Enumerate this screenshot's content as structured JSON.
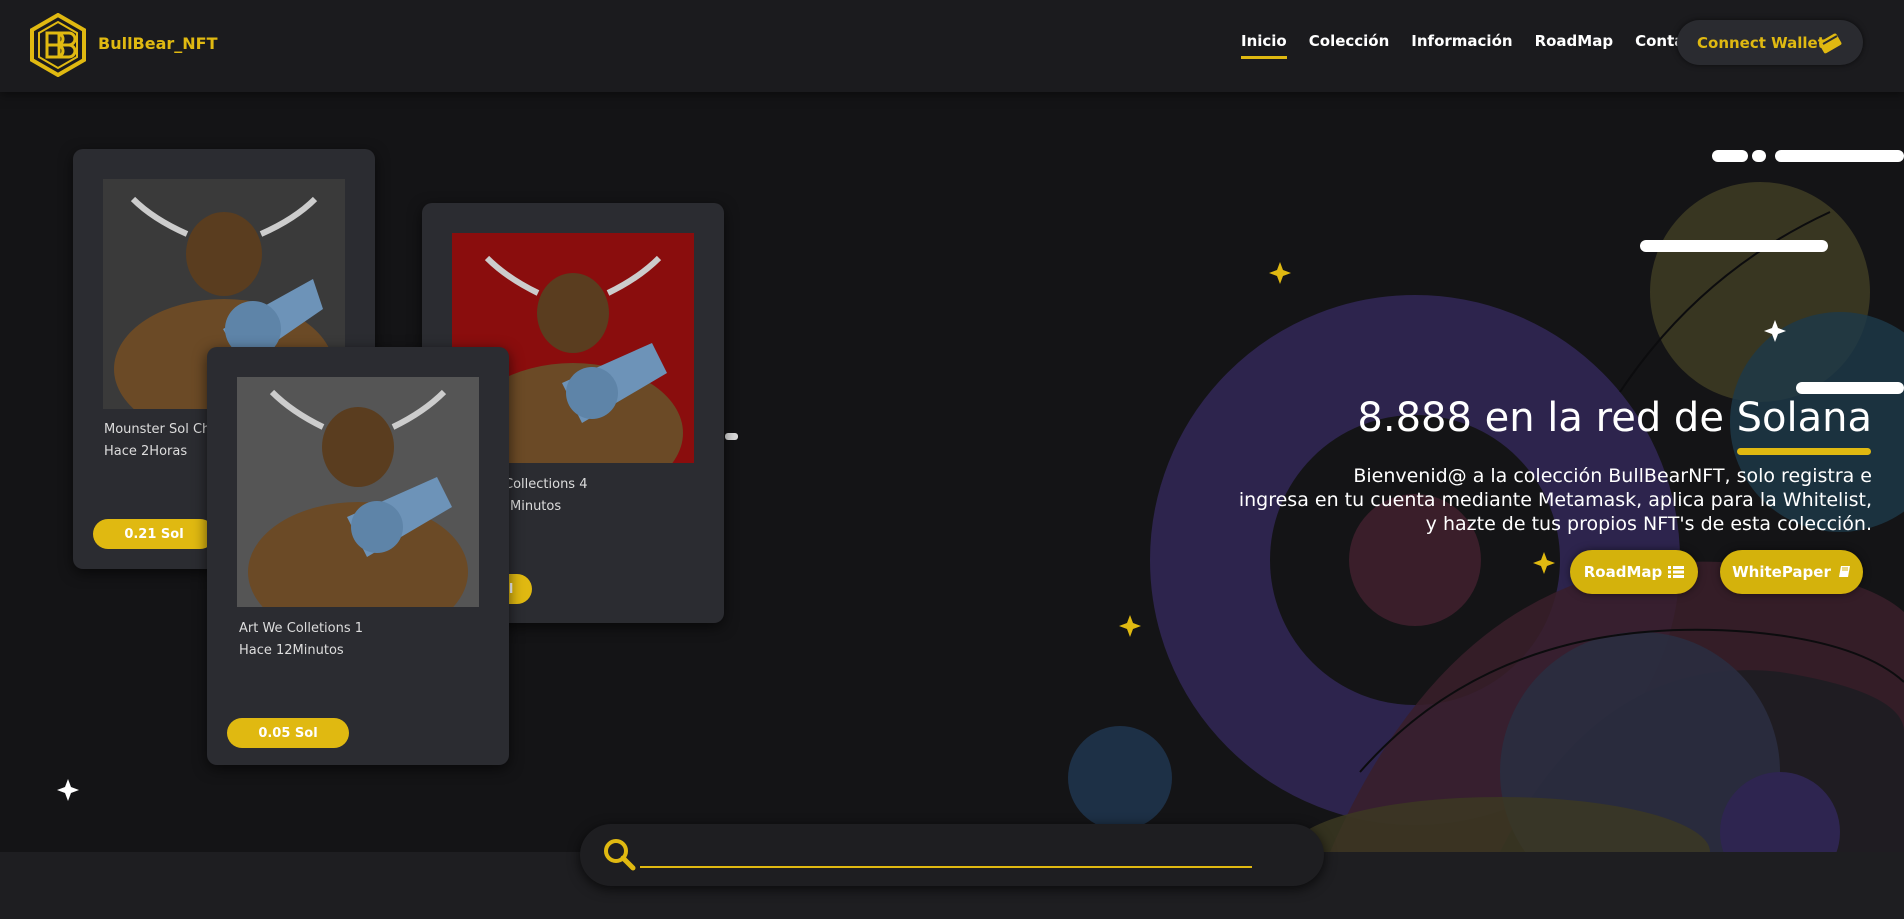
{
  "brand": {
    "name": "BullBear_NFT"
  },
  "nav": [
    {
      "label": "Inicio",
      "active": true
    },
    {
      "label": "Colección"
    },
    {
      "label": "Información"
    },
    {
      "label": "RoadMap"
    },
    {
      "label": "Contácto"
    }
  ],
  "wallet": {
    "label": "Connect Wallet",
    "icon": "wallet-icon"
  },
  "cards": [
    {
      "title": "Mounster Sol Ch",
      "time": "Hace 2Horas",
      "price": "0.21 Sol"
    },
    {
      "title": "Collections 4",
      "time": "Minutos",
      "price": "Sol"
    },
    {
      "title": "Art We Colletions 1",
      "time": "Hace 12Minutos",
      "price": "0.05 Sol"
    }
  ],
  "hero": {
    "title": "8.888 en la red de Solana",
    "text_lines": [
      "Bienvenid@ a la colección BullBearNFT, solo registra e",
      "ingresa en tu cuenta mediante Metamask, aplica para la Whitelist,",
      "y hazte de tus propios NFT's de esta colección."
    ],
    "roadmap_btn": "RoadMap",
    "whitepaper_btn": "WhitePaper"
  },
  "search": {
    "placeholder": "",
    "icon": "search-icon"
  },
  "colors": {
    "accent": "#e0b911",
    "bg": "#141416",
    "card": "#2b2c31"
  }
}
